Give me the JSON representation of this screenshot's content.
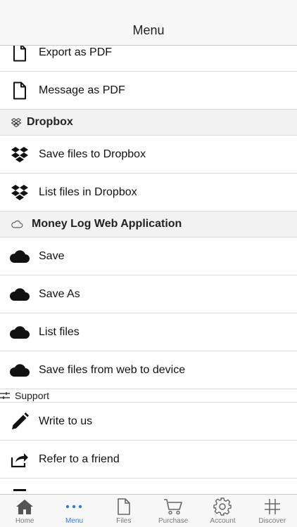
{
  "navbar": {
    "title": "Menu"
  },
  "rows_top": [
    {
      "label": "Export as PDF",
      "icon": "document-icon"
    },
    {
      "label": "Message as PDF",
      "icon": "document-icon"
    }
  ],
  "dropbox_section": {
    "title": "Dropbox",
    "icon": "dropbox-icon"
  },
  "dropbox_rows": [
    {
      "label": "Save files to Dropbox",
      "icon": "dropbox-icon"
    },
    {
      "label": "List files in Dropbox",
      "icon": "dropbox-icon"
    }
  ],
  "web_section": {
    "title": "Money Log Web Application",
    "icon": "cloud-outline-icon"
  },
  "web_rows": [
    {
      "label": "Save",
      "icon": "cloud-icon"
    },
    {
      "label": "Save As",
      "icon": "cloud-icon"
    },
    {
      "label": "List files",
      "icon": "cloud-icon"
    },
    {
      "label": "Save files from web to device",
      "icon": "cloud-icon"
    }
  ],
  "support_section": {
    "title": "Support",
    "icon": "sliders-icon"
  },
  "support_rows": [
    {
      "label": "Write to us",
      "icon": "pencil-icon"
    },
    {
      "label": "Refer to a friend",
      "icon": "share-icon"
    }
  ],
  "tabbar": {
    "active": "Menu",
    "active_color": "#2f7de1",
    "tabs": [
      {
        "label": "Home",
        "icon": "home-icon"
      },
      {
        "label": "Menu",
        "icon": "more-dots-icon"
      },
      {
        "label": "Files",
        "icon": "file-icon"
      },
      {
        "label": "Purchase",
        "icon": "cart-icon"
      },
      {
        "label": "Account",
        "icon": "gear-icon"
      },
      {
        "label": "Discover",
        "icon": "hashtag-icon"
      }
    ]
  }
}
